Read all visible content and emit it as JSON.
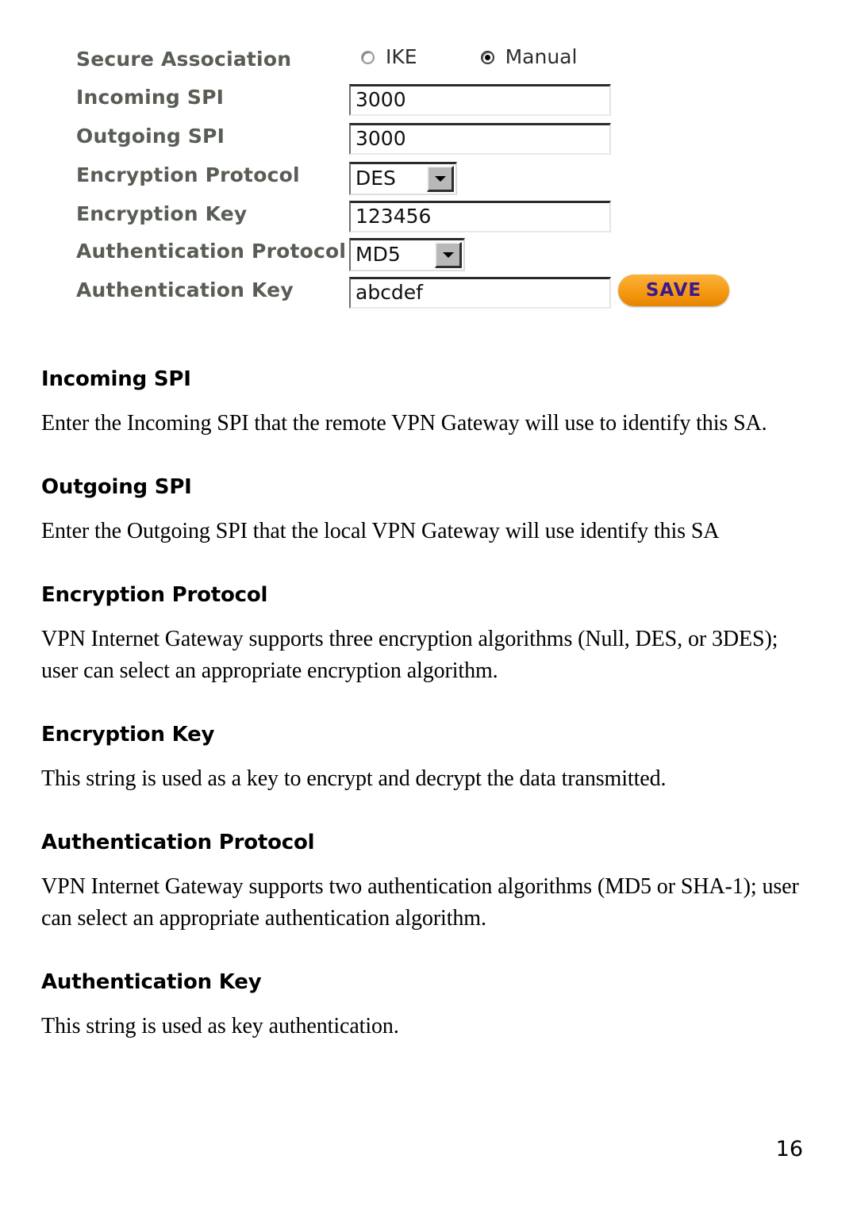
{
  "screenshot": {
    "rows": [
      {
        "label": "Secure Association",
        "type": "radio"
      },
      {
        "label": "Incoming SPI",
        "type": "text",
        "value": "3000"
      },
      {
        "label": "Outgoing SPI",
        "type": "text",
        "value": "3000"
      },
      {
        "label": "Encryption Protocol",
        "type": "select",
        "value": "DES"
      },
      {
        "label": "Encryption Key",
        "type": "text",
        "value": "123456"
      },
      {
        "label": "Authentication Protocol",
        "type": "select",
        "value": "MD5"
      },
      {
        "label": "Authentication Key",
        "type": "text",
        "value": "abcdef"
      }
    ],
    "secure_association": {
      "label": "Secure Association",
      "options": [
        {
          "label": "IKE",
          "selected": false
        },
        {
          "label": "Manual",
          "selected": true
        }
      ]
    },
    "incoming_spi": {
      "label": "Incoming SPI",
      "value": "3000"
    },
    "outgoing_spi": {
      "label": "Outgoing SPI",
      "value": "3000"
    },
    "encryption_protocol": {
      "label": "Encryption Protocol",
      "value": "DES"
    },
    "encryption_key": {
      "label": "Encryption Key",
      "value": "123456"
    },
    "authentication_protocol": {
      "label": "Authentication Protocol",
      "value": "MD5"
    },
    "authentication_key": {
      "label": "Authentication Key",
      "value": "abcdef"
    },
    "save_button": {
      "label": "SAVE",
      "accent_color": "#f7a01c",
      "text_color": "#3b1a8f"
    }
  },
  "document": {
    "sections": [
      {
        "heading": "Incoming SPI",
        "body": "Enter the Incoming SPI that the remote VPN Gateway will use to identify this SA."
      },
      {
        "heading": "Outgoing SPI",
        "body": "Enter the Outgoing SPI that the local VPN Gateway will use identify this SA"
      },
      {
        "heading": "Encryption Protocol",
        "body": "VPN Internet Gateway supports three encryption algorithms (Null, DES, or 3DES); user can select an appropriate encryption algorithm."
      },
      {
        "heading": "Encryption Key",
        "body": "This string is used as a key to encrypt and decrypt the data transmitted."
      },
      {
        "heading": "Authentication Protocol",
        "body": "VPN Internet Gateway supports two authentication algorithms (MD5 or SHA-1); user can select an appropriate authentication algorithm."
      },
      {
        "heading": "Authentication Key",
        "body": "This string is used as key authentication."
      }
    ],
    "page_number": "16"
  }
}
